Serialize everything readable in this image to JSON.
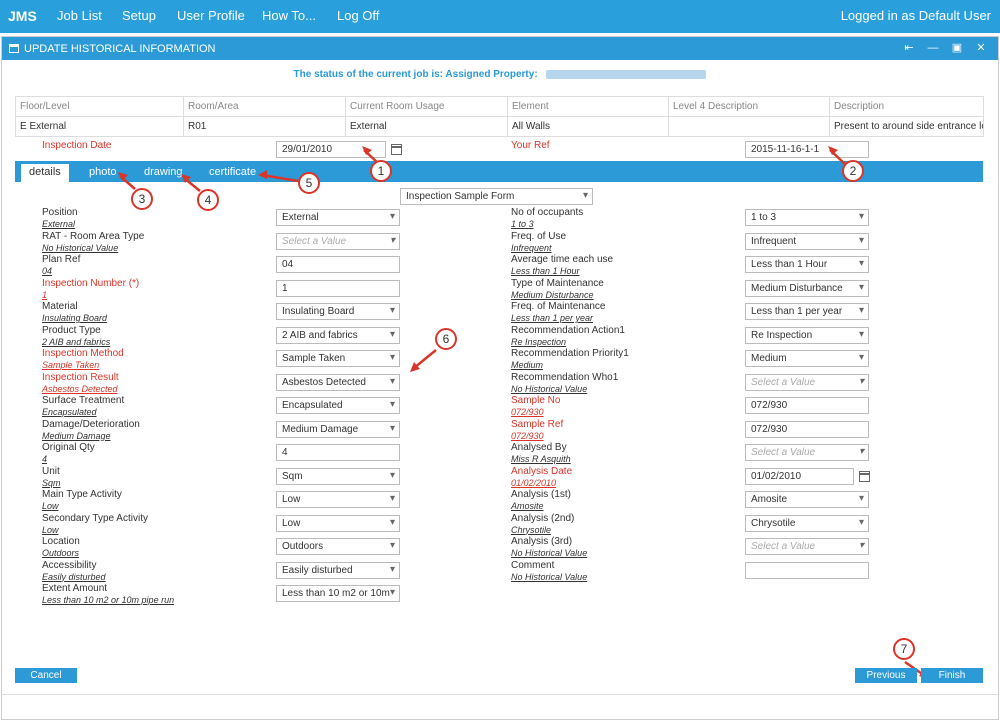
{
  "topnav": {
    "brand": "JMS",
    "items": [
      "Job List",
      "Setup",
      "User Profile",
      "How To...",
      "Log Off"
    ],
    "user": "Logged in as Default User"
  },
  "window": {
    "title": "UPDATE HISTORICAL INFORMATION",
    "status_prefix": "The status of the current job is: Assigned",
    "property_label": "Property:"
  },
  "summary": {
    "headers": [
      "Floor/Level",
      "Room/Area",
      "Current Room Usage",
      "Element",
      "Level 4 Description",
      "Description"
    ],
    "row": [
      "E External",
      "R01",
      "External",
      "All Walls",
      "",
      "Present to around side entrance lobby"
    ]
  },
  "header_fields": {
    "inspection_date_label": "Inspection Date",
    "inspection_date_value": "29/01/2010",
    "your_ref_label": "Your Ref",
    "your_ref_value": "2015-11-16-1-1"
  },
  "tabs": [
    "details",
    "photo",
    "drawing",
    "certificate"
  ],
  "form_select": "Inspection Sample Form",
  "left_fields": [
    {
      "label": "Position",
      "hist": "External",
      "value": "External",
      "type": "select",
      "red": false
    },
    {
      "label": "RAT - Room Area Type",
      "hist": "No Historical Value",
      "value": "Select a Value",
      "type": "select-ph",
      "red": false
    },
    {
      "label": "Plan Ref",
      "hist": "04",
      "value": "04",
      "type": "input",
      "red": false
    },
    {
      "label": "Inspection Number (*)",
      "hist": "1",
      "value": "1",
      "type": "input",
      "red": true
    },
    {
      "label": "Material",
      "hist": "Insulating Board",
      "value": "Insulating Board",
      "type": "select",
      "red": false
    },
    {
      "label": "Product Type",
      "hist": "2 AIB and fabrics",
      "value": "2 AIB and fabrics",
      "type": "select",
      "red": false
    },
    {
      "label": "Inspection Method",
      "hist": "Sample Taken",
      "value": "Sample Taken",
      "type": "select",
      "red": true
    },
    {
      "label": "Inspection Result",
      "hist": "Asbestos Detected",
      "value": "Asbestos Detected",
      "type": "select",
      "red": true
    },
    {
      "label": "Surface Treatment",
      "hist": "Encapsulated",
      "value": "Encapsulated",
      "type": "select",
      "red": false
    },
    {
      "label": "Damage/Deterioration",
      "hist": "Medium Damage",
      "value": "Medium Damage",
      "type": "select",
      "red": false
    },
    {
      "label": "Original Qty",
      "hist": "4",
      "value": "4",
      "type": "input",
      "red": false
    },
    {
      "label": "Unit",
      "hist": "Sqm",
      "value": "Sqm",
      "type": "select",
      "red": false
    },
    {
      "label": "Main Type Activity",
      "hist": "Low",
      "value": "Low",
      "type": "select",
      "red": false
    },
    {
      "label": "Secondary Type Activity",
      "hist": "Low",
      "value": "Low",
      "type": "select",
      "red": false
    },
    {
      "label": "Location",
      "hist": "Outdoors",
      "value": "Outdoors",
      "type": "select",
      "red": false
    },
    {
      "label": "Accessibility",
      "hist": "Easily disturbed",
      "value": "Easily disturbed",
      "type": "select",
      "red": false
    },
    {
      "label": "Extent Amount",
      "hist": "Less than 10 m2 or 10m pipe run",
      "value": "Less than 10 m2 or 10m",
      "type": "select",
      "red": false
    }
  ],
  "right_fields": [
    {
      "label": "No of occupants",
      "hist": "1 to 3",
      "value": "1 to 3",
      "type": "select",
      "red": false
    },
    {
      "label": "Freq. of Use",
      "hist": "Infrequent",
      "value": "Infrequent",
      "type": "select",
      "red": false
    },
    {
      "label": "Average time each use",
      "hist": "Less than 1 Hour",
      "value": "Less than 1 Hour",
      "type": "select",
      "red": false
    },
    {
      "label": "Type of Maintenance",
      "hist": "Medium Disturbance",
      "value": "Medium Disturbance",
      "type": "select",
      "red": false
    },
    {
      "label": "Freq. of Maintenance",
      "hist": "Less than 1 per year",
      "value": "Less than 1 per year",
      "type": "select",
      "red": false
    },
    {
      "label": "Recommendation Action1",
      "hist": "Re Inspection",
      "value": "Re Inspection",
      "type": "select",
      "red": false
    },
    {
      "label": "Recommendation Priority1",
      "hist": "Medium",
      "value": "Medium",
      "type": "select",
      "red": false
    },
    {
      "label": "Recommendation Who1",
      "hist": "No Historical Value",
      "value": "Select a Value",
      "type": "select-ph",
      "red": false
    },
    {
      "label": "Sample No",
      "hist": "072/930",
      "value": "072/930",
      "type": "input",
      "red": true
    },
    {
      "label": "Sample Ref",
      "hist": "072/930",
      "value": "072/930",
      "type": "input",
      "red": true
    },
    {
      "label": "Analysed By",
      "hist": "Miss R Asquith",
      "value": "Select a Value",
      "type": "select-ph",
      "red": false
    },
    {
      "label": "Analysis Date",
      "hist": "01/02/2010",
      "value": "01/02/2010",
      "type": "date",
      "red": true
    },
    {
      "label": "Analysis (1st)",
      "hist": "Amosite",
      "value": "Amosite",
      "type": "select",
      "red": false
    },
    {
      "label": "Analysis (2nd)",
      "hist": "Chrysotile",
      "value": "Chrysotile",
      "type": "select",
      "red": false
    },
    {
      "label": "Analysis (3rd)",
      "hist": "No Historical Value",
      "value": "Select a Value",
      "type": "select-ph",
      "red": false
    },
    {
      "label": "Comment",
      "hist": "No Historical Value",
      "value": "",
      "type": "input",
      "red": false
    }
  ],
  "buttons": {
    "cancel": "Cancel",
    "previous": "Previous",
    "finish": "Finish"
  },
  "callouts": [
    "1",
    "2",
    "3",
    "4",
    "5",
    "6",
    "7"
  ],
  "colors": {
    "accent": "#29a0db",
    "required": "#d9352a"
  }
}
